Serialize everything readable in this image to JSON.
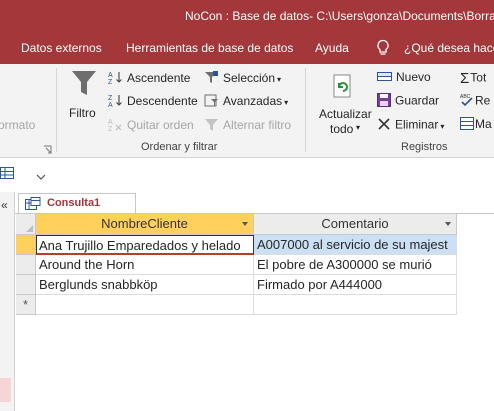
{
  "window": {
    "title": "NoCon : Base de datos- C:\\Users\\gonza\\Documents\\Borrar"
  },
  "menu": {
    "tabs": [
      "Datos externos",
      "Herramientas de base de datos",
      "Ayuda"
    ],
    "tell_me": "¿Qué desea hacer"
  },
  "ribbon": {
    "formato_fragment": "ormato",
    "sort_filter": {
      "filtro": "Filtro",
      "ascendente": "Ascendente",
      "descendente": "Descendente",
      "quitar_orden": "Quitar orden",
      "seleccion": "Selección",
      "avanzadas": "Avanzadas",
      "alternar_filtro": "Alternar filtro",
      "group_label": "Ordenar y filtrar"
    },
    "records": {
      "actualizar_line1": "Actualizar",
      "actualizar_line2": "todo",
      "nuevo": "Nuevo",
      "guardar": "Guardar",
      "eliminar": "Eliminar",
      "group_label": "Registros",
      "totales_fragment": "Tot",
      "revision_fragment": "Re",
      "mas_fragment": "Ma"
    }
  },
  "document": {
    "tab_label": "Consulta1"
  },
  "datasheet": {
    "columns": [
      "NombreCliente",
      "Comentario"
    ],
    "rows": [
      [
        "Ana Trujillo Emparedados y helado",
        "A007000 al servicio de su majest"
      ],
      [
        "Around the Horn",
        "El pobre de A300000 se murió"
      ],
      [
        "Berglunds snabbköp",
        "Firmado por A444000"
      ]
    ],
    "new_row_marker": "*"
  },
  "colors": {
    "accent": "#a4373a",
    "selection_header": "#ffd15c",
    "cell_highlight": "#cce0f5"
  }
}
